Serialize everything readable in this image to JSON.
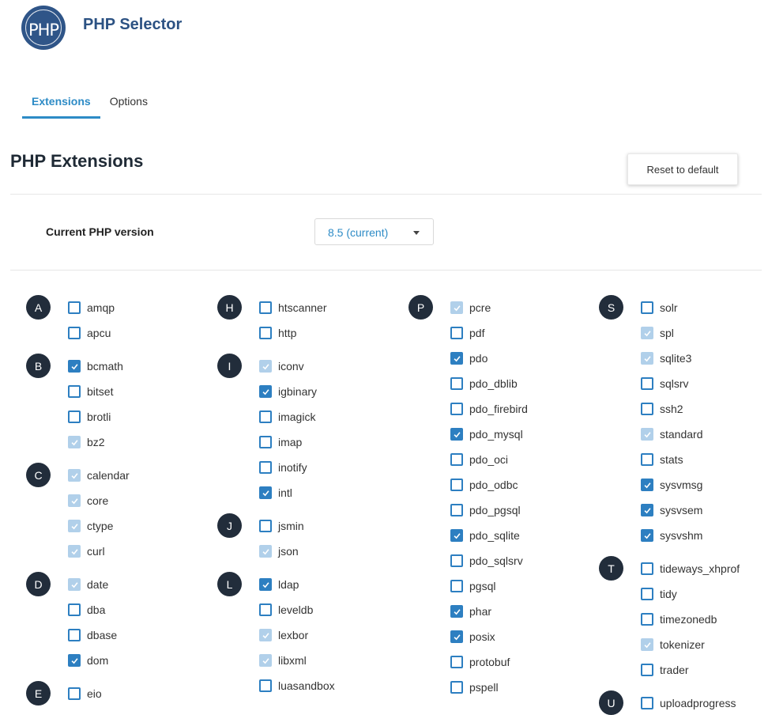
{
  "app": {
    "logo_text": "PHP",
    "title": "PHP Selector"
  },
  "tabs": [
    {
      "label": "Extensions",
      "active": true
    },
    {
      "label": "Options",
      "active": false
    }
  ],
  "section": {
    "title": "PHP Extensions",
    "reset_label": "Reset to default"
  },
  "version": {
    "label": "Current PHP version",
    "value": "8.5 (current)"
  },
  "colors": {
    "accent": "#2d8bc6",
    "checkbox": "#2d7fc1",
    "checkbox_default": "#b1d0ea",
    "letter_badge": "#222d3b",
    "title": "#2c5283"
  },
  "columns": [
    {
      "groups": [
        {
          "letter": "A",
          "items": [
            {
              "name": "amqp",
              "state": "off"
            },
            {
              "name": "apcu",
              "state": "off"
            }
          ]
        },
        {
          "letter": "B",
          "items": [
            {
              "name": "bcmath",
              "state": "on"
            },
            {
              "name": "bitset",
              "state": "off"
            },
            {
              "name": "brotli",
              "state": "off"
            },
            {
              "name": "bz2",
              "state": "default"
            }
          ]
        },
        {
          "letter": "C",
          "items": [
            {
              "name": "calendar",
              "state": "default"
            },
            {
              "name": "core",
              "state": "default"
            },
            {
              "name": "ctype",
              "state": "default"
            },
            {
              "name": "curl",
              "state": "default"
            }
          ]
        },
        {
          "letter": "D",
          "items": [
            {
              "name": "date",
              "state": "default"
            },
            {
              "name": "dba",
              "state": "off"
            },
            {
              "name": "dbase",
              "state": "off"
            },
            {
              "name": "dom",
              "state": "on"
            }
          ]
        },
        {
          "letter": "E",
          "items": [
            {
              "name": "eio",
              "state": "off"
            }
          ]
        }
      ]
    },
    {
      "groups": [
        {
          "letter": "H",
          "items": [
            {
              "name": "htscanner",
              "state": "off"
            },
            {
              "name": "http",
              "state": "off"
            }
          ]
        },
        {
          "letter": "I",
          "items": [
            {
              "name": "iconv",
              "state": "default"
            },
            {
              "name": "igbinary",
              "state": "on"
            },
            {
              "name": "imagick",
              "state": "off"
            },
            {
              "name": "imap",
              "state": "off"
            },
            {
              "name": "inotify",
              "state": "off"
            },
            {
              "name": "intl",
              "state": "on"
            }
          ]
        },
        {
          "letter": "J",
          "items": [
            {
              "name": "jsmin",
              "state": "off"
            },
            {
              "name": "json",
              "state": "default"
            }
          ]
        },
        {
          "letter": "L",
          "items": [
            {
              "name": "ldap",
              "state": "on"
            },
            {
              "name": "leveldb",
              "state": "off"
            },
            {
              "name": "lexbor",
              "state": "default"
            },
            {
              "name": "libxml",
              "state": "default"
            },
            {
              "name": "luasandbox",
              "state": "off"
            }
          ]
        }
      ]
    },
    {
      "groups": [
        {
          "letter": "P",
          "items": [
            {
              "name": "pcre",
              "state": "default"
            },
            {
              "name": "pdf",
              "state": "off"
            },
            {
              "name": "pdo",
              "state": "on"
            },
            {
              "name": "pdo_dblib",
              "state": "off"
            },
            {
              "name": "pdo_firebird",
              "state": "off"
            },
            {
              "name": "pdo_mysql",
              "state": "on"
            },
            {
              "name": "pdo_oci",
              "state": "off"
            },
            {
              "name": "pdo_odbc",
              "state": "off"
            },
            {
              "name": "pdo_pgsql",
              "state": "off"
            },
            {
              "name": "pdo_sqlite",
              "state": "on"
            },
            {
              "name": "pdo_sqlsrv",
              "state": "off"
            },
            {
              "name": "pgsql",
              "state": "off"
            },
            {
              "name": "phar",
              "state": "on"
            },
            {
              "name": "posix",
              "state": "on"
            },
            {
              "name": "protobuf",
              "state": "off"
            },
            {
              "name": "pspell",
              "state": "off"
            }
          ]
        }
      ]
    },
    {
      "groups": [
        {
          "letter": "S",
          "items": [
            {
              "name": "solr",
              "state": "off"
            },
            {
              "name": "spl",
              "state": "default"
            },
            {
              "name": "sqlite3",
              "state": "default"
            },
            {
              "name": "sqlsrv",
              "state": "off"
            },
            {
              "name": "ssh2",
              "state": "off"
            },
            {
              "name": "standard",
              "state": "default"
            },
            {
              "name": "stats",
              "state": "off"
            },
            {
              "name": "sysvmsg",
              "state": "on"
            },
            {
              "name": "sysvsem",
              "state": "on"
            },
            {
              "name": "sysvshm",
              "state": "on"
            }
          ]
        },
        {
          "letter": "T",
          "items": [
            {
              "name": "tideways_xhprof",
              "state": "off"
            },
            {
              "name": "tidy",
              "state": "off"
            },
            {
              "name": "timezonedb",
              "state": "off"
            },
            {
              "name": "tokenizer",
              "state": "default"
            },
            {
              "name": "trader",
              "state": "off"
            }
          ]
        },
        {
          "letter": "U",
          "items": [
            {
              "name": "uploadprogress",
              "state": "off"
            }
          ]
        }
      ]
    }
  ]
}
